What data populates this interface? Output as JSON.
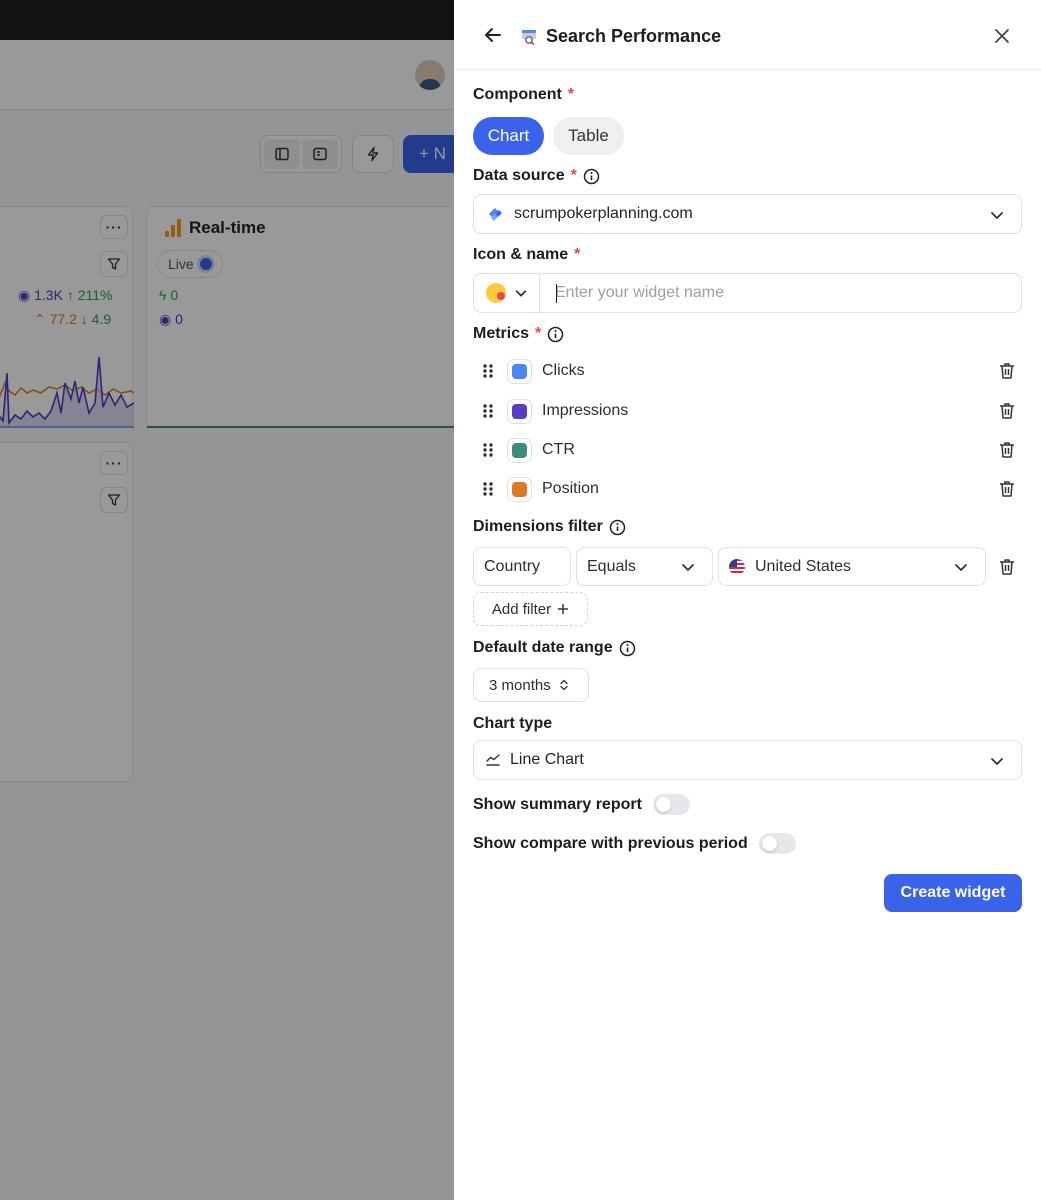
{
  "background": {
    "new_button_label": "+ N",
    "realtime_card": {
      "title": "Real-time",
      "live_label": "Live",
      "events": "0",
      "views": "0"
    },
    "left_card": {
      "views": "1.3K",
      "views_change": "↑ 211%",
      "position": "77.2",
      "position_change": "↓ 4.9"
    }
  },
  "panel": {
    "title": "Search Performance",
    "component": {
      "label": "Component",
      "required": "*",
      "options": [
        "Chart",
        "Table"
      ],
      "selected": "Chart"
    },
    "data_source": {
      "label": "Data source",
      "required": "*",
      "value": "scrumpokerplanning.com"
    },
    "icon_name": {
      "label": "Icon & name",
      "required": "*",
      "placeholder": "Enter your widget name",
      "value": ""
    },
    "metrics": {
      "label": "Metrics",
      "required": "*",
      "items": [
        {
          "name": "Clicks",
          "color": "#4f86f7"
        },
        {
          "name": "Impressions",
          "color": "#5b3cc4"
        },
        {
          "name": "CTR",
          "color": "#3f8a7c"
        },
        {
          "name": "Position",
          "color": "#e07b24"
        }
      ]
    },
    "dimensions_filter": {
      "label": "Dimensions filter",
      "dimension": "Country",
      "operator": "Equals",
      "value": "United States",
      "add_label": "Add filter"
    },
    "date_range": {
      "label": "Default date range",
      "value": "3 months"
    },
    "chart_type": {
      "label": "Chart type",
      "value": "Line Chart"
    },
    "toggles": {
      "summary": {
        "label": "Show summary report",
        "on": false
      },
      "compare": {
        "label": "Show compare with previous period",
        "on": false
      }
    },
    "create_label": "Create widget"
  },
  "colors": {
    "accent": "#3a63ea",
    "required": "#e5484d"
  }
}
